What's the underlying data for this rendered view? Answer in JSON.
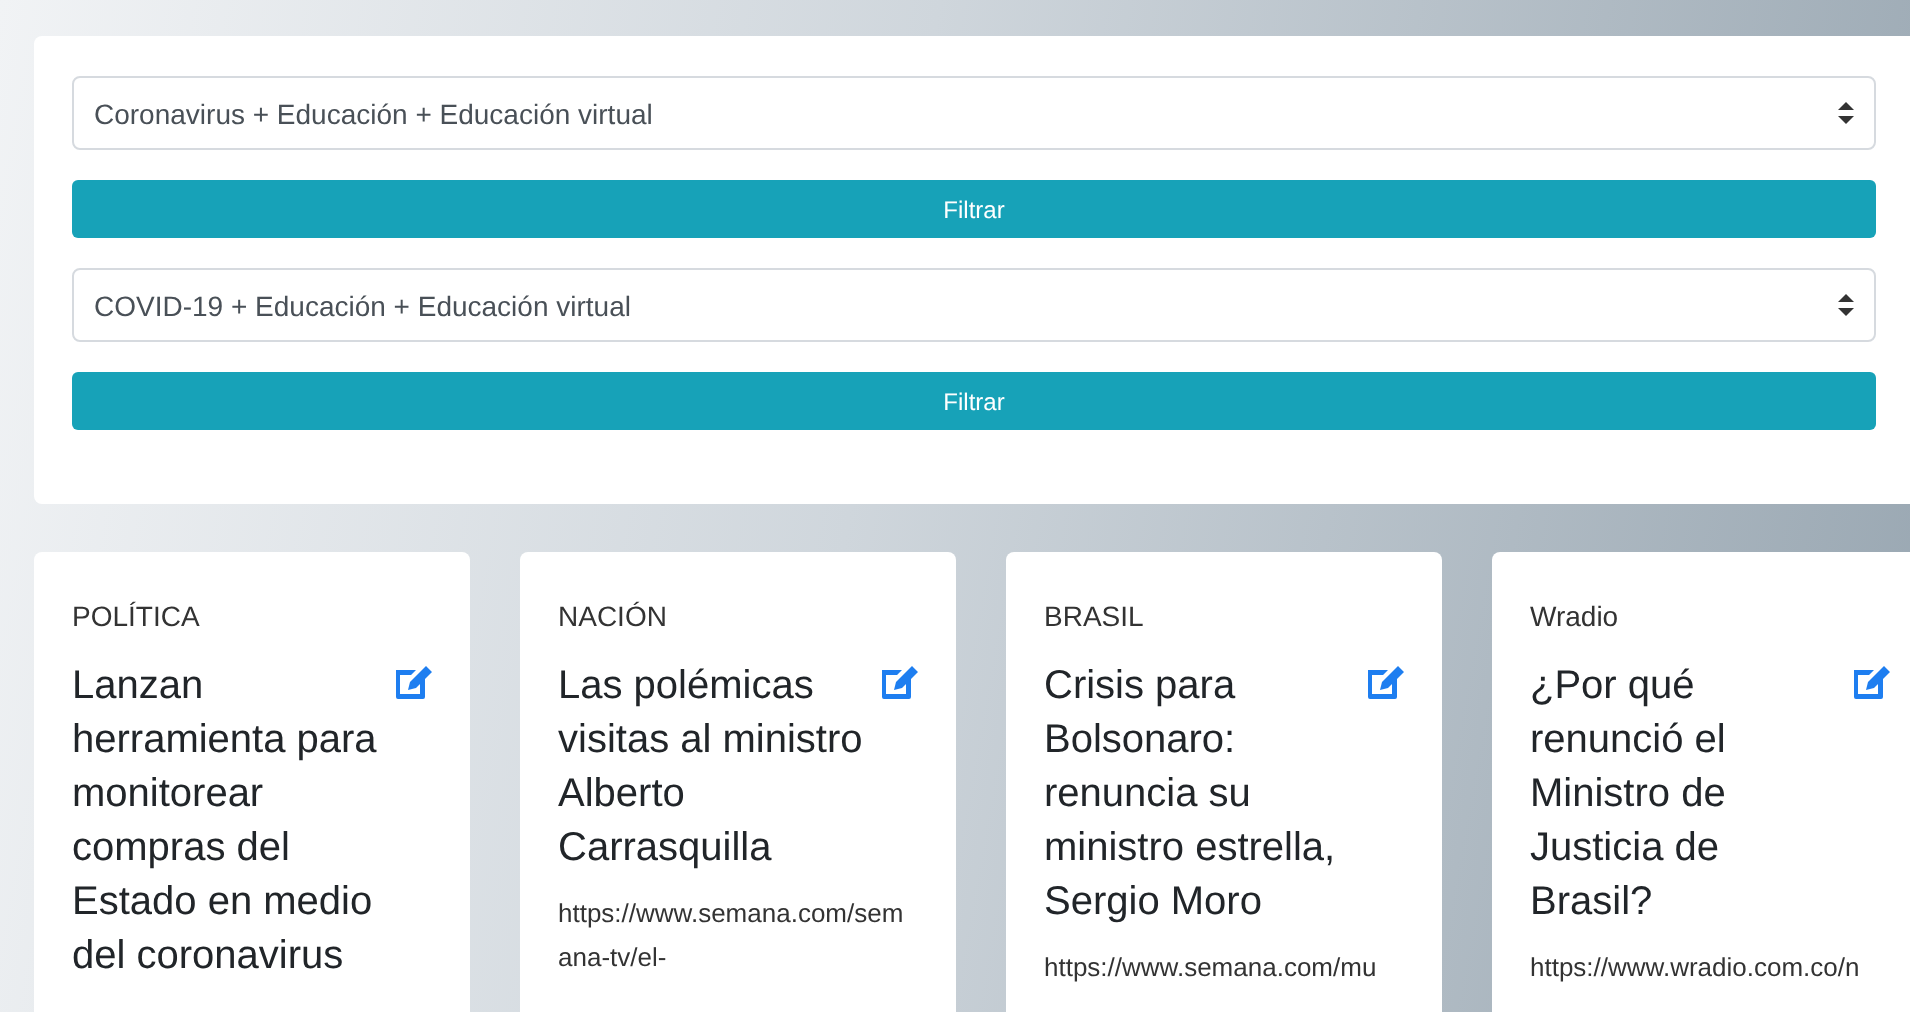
{
  "filters": [
    {
      "select": {
        "value": "Coronavirus + Educación + Educación virtual"
      },
      "button": "Filtrar"
    },
    {
      "select": {
        "value": "COVID-19 + Educación + Educación virtual"
      },
      "button": "Filtrar"
    }
  ],
  "cards": [
    {
      "section": "POLÍTICA",
      "title": "Lanzan herramienta para monitorear compras del Estado en medio del coronavirus"
    },
    {
      "section": "NACIÓN",
      "title": "Las polémicas visitas al ministro Alberto Carrasquilla",
      "url": "https://www.semana.com/semana-tv/el-"
    },
    {
      "section": "BRASIL",
      "title": "Crisis para Bolsonaro: renuncia su ministro estrella, Sergio Moro",
      "url": "https://www.semana.com/mu"
    },
    {
      "section": "Wradio",
      "title": "¿Por qué renunció el Ministro de Justicia de Brasil?",
      "url": "https://www.wradio.com.co/n"
    }
  ]
}
